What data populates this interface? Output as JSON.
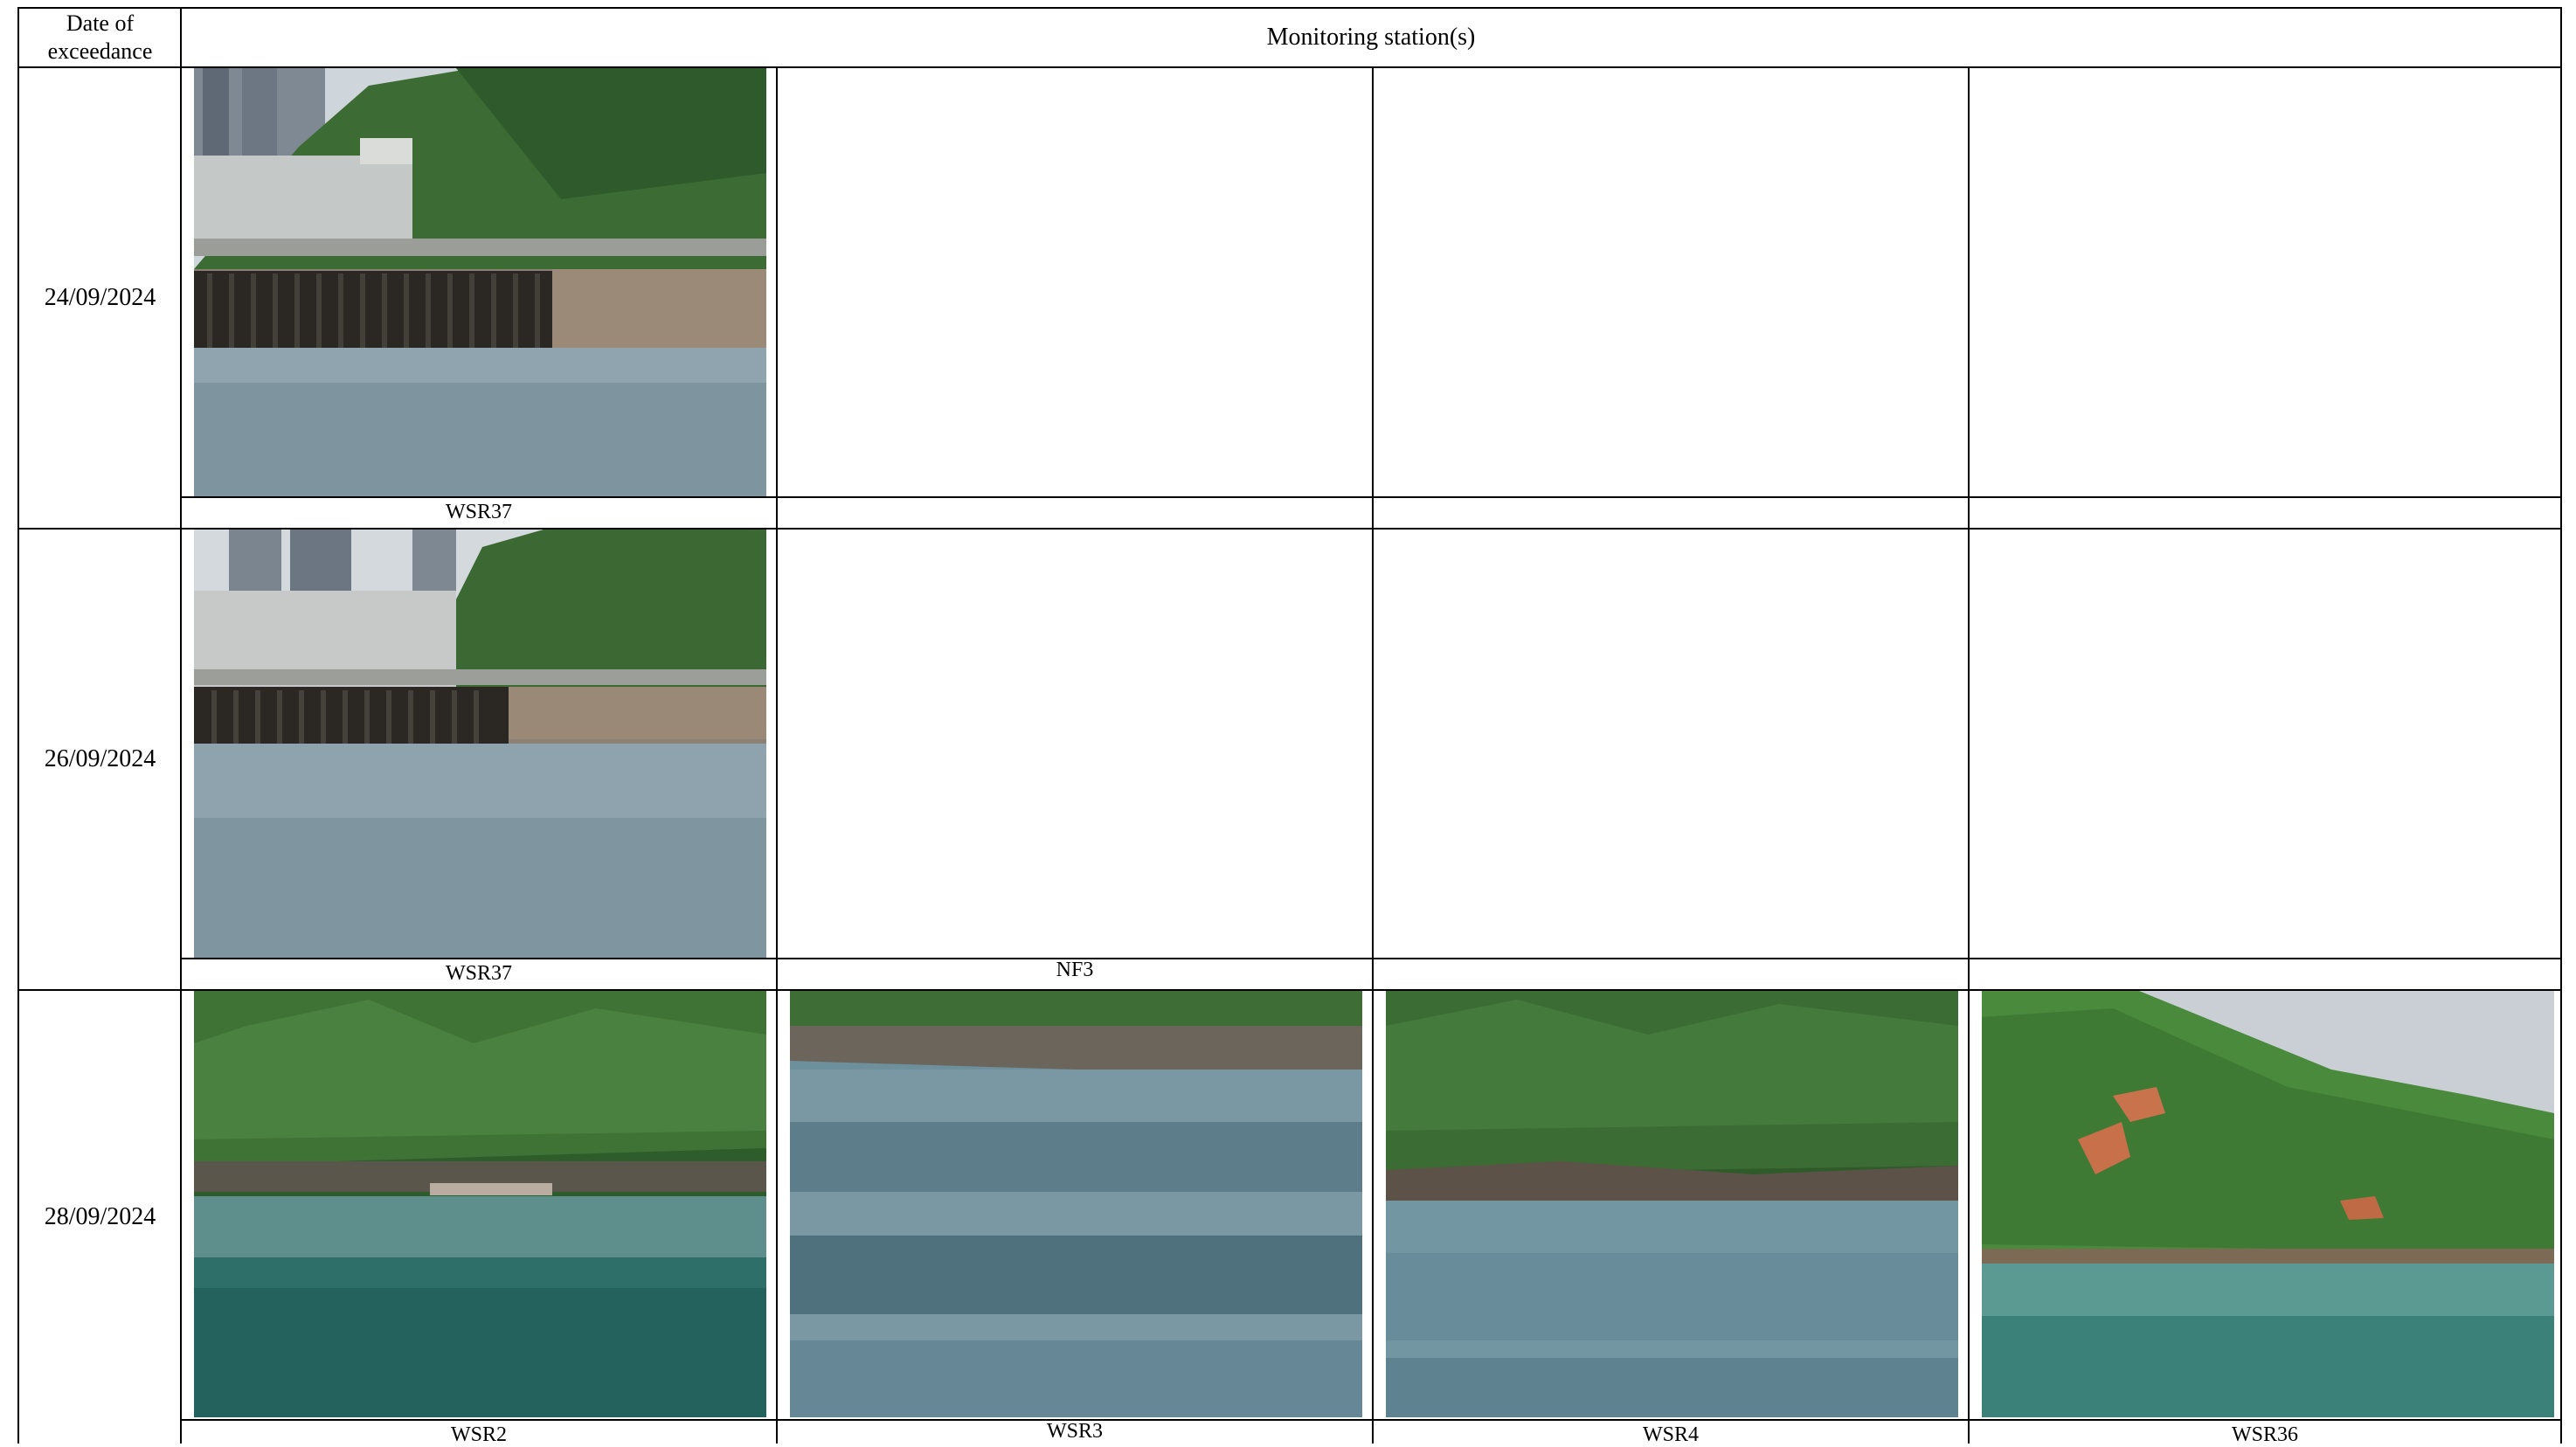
{
  "table": {
    "header": {
      "date_col": "Date of\nexceedance",
      "station_col": "Monitoring station(s)"
    },
    "rows": [
      {
        "date": "24/09/2024",
        "cells": [
          {
            "label": "WSR37",
            "photo": "wsr37-shore-sep24"
          },
          {
            "label": "",
            "photo": null
          },
          {
            "label": "",
            "photo": null
          },
          {
            "label": "",
            "photo": null
          }
        ]
      },
      {
        "date": "26/09/2024",
        "cells": [
          {
            "label": "WSR37",
            "photo": "wsr37-shore-sep26"
          },
          {
            "label": "NF3",
            "photo": null
          },
          {
            "label": "",
            "photo": null
          },
          {
            "label": "",
            "photo": null
          }
        ]
      },
      {
        "date": "28/09/2024",
        "cells": [
          {
            "label": "WSR2",
            "photo": "wsr2-shore"
          },
          {
            "label": "WSR3",
            "photo": "wsr3-water"
          },
          {
            "label": "WSR4",
            "photo": "wsr4-shore"
          },
          {
            "label": "WSR36",
            "photo": "wsr36-hillside"
          }
        ]
      }
    ]
  }
}
